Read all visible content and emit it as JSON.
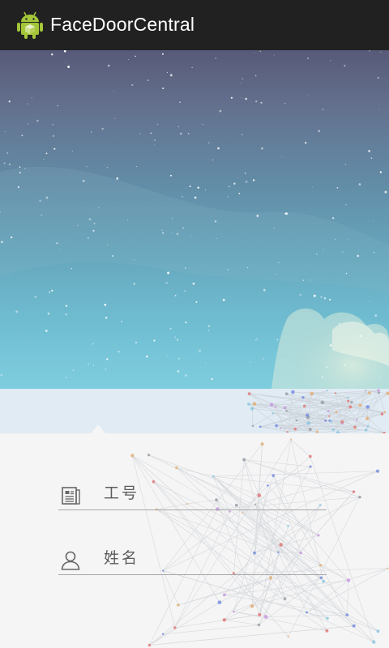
{
  "app": {
    "title": "FaceDoorCentral",
    "icon": "android-robot-icon"
  },
  "form": {
    "employee_id": {
      "placeholder": "工号",
      "value": "",
      "icon": "id-card-icon"
    },
    "name": {
      "placeholder": "姓名",
      "value": "",
      "icon": "user-icon"
    }
  },
  "colors": {
    "action_bar": "#212121",
    "accent": "#a4c639",
    "strip": "#e0ebf3",
    "background": "#f5f5f5"
  }
}
